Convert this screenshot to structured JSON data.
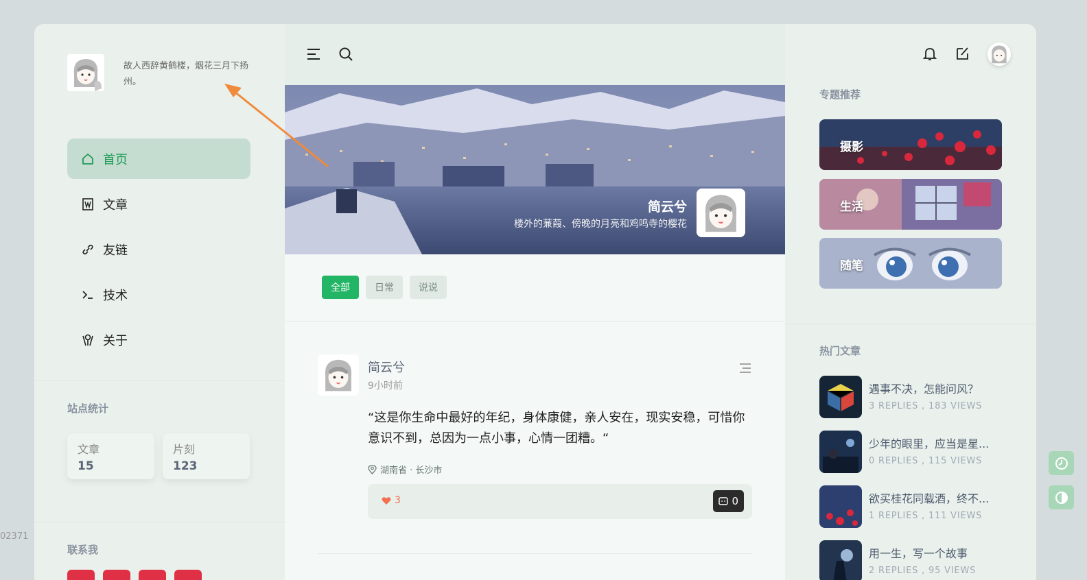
{
  "profile": {
    "motto": "故人西辞黄鹤楼，烟花三月下扬州。"
  },
  "nav": [
    {
      "label": "首页",
      "icon": "home-icon",
      "active": true
    },
    {
      "label": "文章",
      "icon": "article-icon",
      "active": false
    },
    {
      "label": "友链",
      "icon": "link-icon",
      "active": false
    },
    {
      "label": "技术",
      "icon": "terminal-icon",
      "active": false
    },
    {
      "label": "关于",
      "icon": "about-icon",
      "active": false
    }
  ],
  "stats": {
    "title": "站点统计",
    "articles_label": "文章",
    "articles_value": "15",
    "moments_label": "片刻",
    "moments_value": "123"
  },
  "contact": {
    "title": "联系我"
  },
  "edge_text": "02371",
  "banner": {
    "owner": "简云兮",
    "signature": "楼外的蒹葭、傍晚的月亮和鸡鸣寺的樱花"
  },
  "filters": [
    "全部",
    "日常",
    "说说"
  ],
  "post": {
    "author": "简云兮",
    "time": "9小时前",
    "text": "“这是你生命中最好的年纪，身体康健，亲人安在，现实安稳，可惜你意识不到，总因为一点小事，心情一团糟。“",
    "location": "湖南省 · 长沙市",
    "likes": "3",
    "comments": "0"
  },
  "right": {
    "topics_title": "专题推荐",
    "topics": [
      "摄影",
      "生活",
      "随笔"
    ],
    "hot_title": "热门文章",
    "hot": [
      {
        "title": "遇事不决，怎能问风？",
        "meta": "3 REPLIES ,  183 VIEWS"
      },
      {
        "title": "少年的眼里，应当是星...",
        "meta": "0 REPLIES ,  115 VIEWS"
      },
      {
        "title": "欲买桂花同载酒，终不...",
        "meta": "1 REPLIES ,  111 VIEWS"
      },
      {
        "title": "用一生，写一个故事",
        "meta": "2 REPLIES ,  95 VIEWS"
      }
    ]
  },
  "colors": {
    "accent": "#22b565",
    "active_nav_bg": "#c5ddd0",
    "annotation_arrow": "#f08a3c"
  }
}
